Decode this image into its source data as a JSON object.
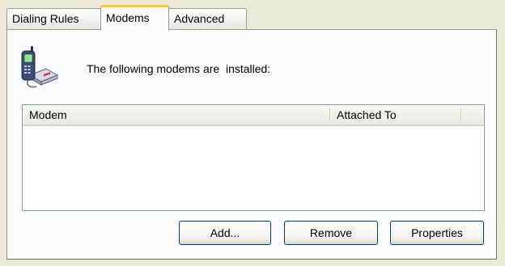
{
  "tabs": [
    {
      "label": "Dialing Rules",
      "selected": false
    },
    {
      "label": "Modems",
      "selected": true
    },
    {
      "label": "Advanced",
      "selected": false
    }
  ],
  "panel": {
    "intro_text": "The following modems are  installed:",
    "icon": "modem-phone-icon"
  },
  "modem_list": {
    "columns": [
      "Modem",
      "Attached To"
    ],
    "rows": []
  },
  "buttons": {
    "add": "Add...",
    "remove": "Remove",
    "properties": "Properties"
  },
  "colors": {
    "window_bg": "#ece9d8",
    "panel_bg": "#fcfcfe",
    "selected_tab_accent": "#ffc83c",
    "button_border": "#003c74",
    "list_border": "#7f9db9"
  }
}
